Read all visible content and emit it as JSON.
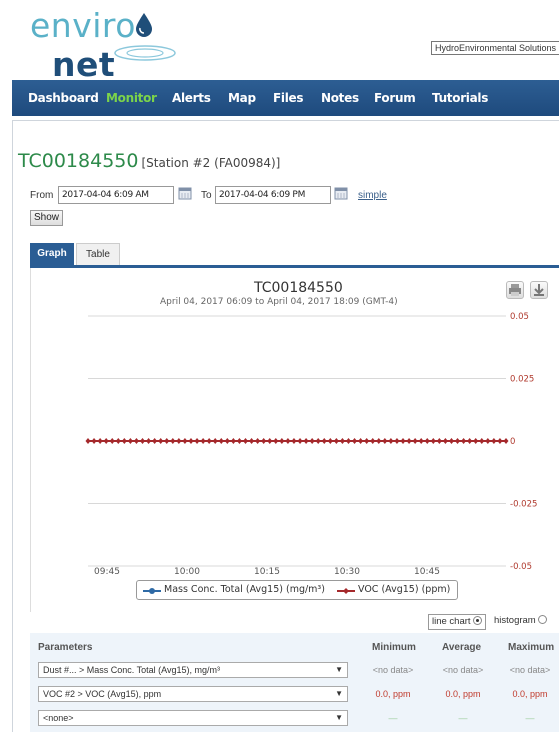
{
  "logo": {
    "word_light": "enviro",
    "word_bold": "net"
  },
  "partner": {
    "label": "HydroEnvironmental Solutions"
  },
  "nav": {
    "items": [
      {
        "label": "Dashboard",
        "active": false
      },
      {
        "label": "Monitor",
        "active": true
      },
      {
        "label": "Alerts",
        "active": false
      },
      {
        "label": "Map",
        "active": false
      },
      {
        "label": "Files",
        "active": false
      },
      {
        "label": "Notes",
        "active": false
      },
      {
        "label": "Forum",
        "active": false
      },
      {
        "label": "Tutorials",
        "active": false
      }
    ]
  },
  "station": {
    "id": "TC00184550",
    "subtitle": "[Station #2 (FA00984)]"
  },
  "range": {
    "from_label": "From",
    "from_value": "2017-04-04 6:09 AM",
    "to_label": "To",
    "to_value": "2017-04-04 6:09 PM",
    "simple_link": "simple",
    "show_button": "Show"
  },
  "tabs": {
    "graph": "Graph",
    "table": "Table"
  },
  "chart_data": {
    "type": "line",
    "title": "TC00184550",
    "subtitle": "April 04, 2017 06:09 to April 04, 2017 18:09 (GMT-4)",
    "x_ticks": [
      "09:45",
      "10:00",
      "10:15",
      "10:30",
      "10:45"
    ],
    "y_ticks": [
      "0.05",
      "0.025",
      "0",
      "-0.025",
      "-0.05"
    ],
    "ylim": [
      -0.05,
      0.05
    ],
    "grid": true,
    "legend_position": "bottom",
    "series": [
      {
        "name": "Mass Conc. Total (Avg15) (mg/m³)",
        "color": "#2f6aa6",
        "values": []
      },
      {
        "name": "VOC (Avg15) (ppm)",
        "color": "#a5292c",
        "values": [
          0,
          0,
          0,
          0,
          0,
          0,
          0,
          0,
          0,
          0,
          0,
          0,
          0,
          0,
          0,
          0,
          0,
          0,
          0,
          0,
          0,
          0,
          0,
          0,
          0,
          0,
          0,
          0,
          0,
          0,
          0,
          0,
          0,
          0,
          0,
          0,
          0,
          0,
          0,
          0,
          0,
          0,
          0,
          0,
          0,
          0,
          0,
          0,
          0,
          0,
          0,
          0,
          0,
          0,
          0,
          0,
          0,
          0,
          0,
          0,
          0,
          0,
          0,
          0,
          0,
          0,
          0,
          0,
          0,
          0
        ]
      }
    ]
  },
  "chart_type": {
    "line_label": "line chart",
    "hist_label": "histogram",
    "selected": "line chart"
  },
  "params": {
    "headers": {
      "parameters": "Parameters",
      "minimum": "Minimum",
      "average": "Average",
      "maximum": "Maximum"
    },
    "rows": [
      {
        "param": "Dust #... > Mass Conc. Total (Avg15), mg/m³",
        "min": "<no data>",
        "avg": "<no data>",
        "max": "<no data>",
        "kind": "nodata"
      },
      {
        "param": "VOC #2 > VOC (Avg15), ppm",
        "min": "0.0, ppm",
        "avg": "0.0, ppm",
        "max": "0.0, ppm",
        "kind": "val"
      },
      {
        "param": "<none>",
        "min": "—",
        "avg": "—",
        "max": "—",
        "kind": "dash"
      }
    ]
  },
  "colors": {
    "nav_bg": "#1e4a7d",
    "nav_active": "#7cd44a",
    "station_id": "#2d8a4a",
    "voc_series": "#a5292c",
    "mass_series": "#2f6aa6"
  }
}
